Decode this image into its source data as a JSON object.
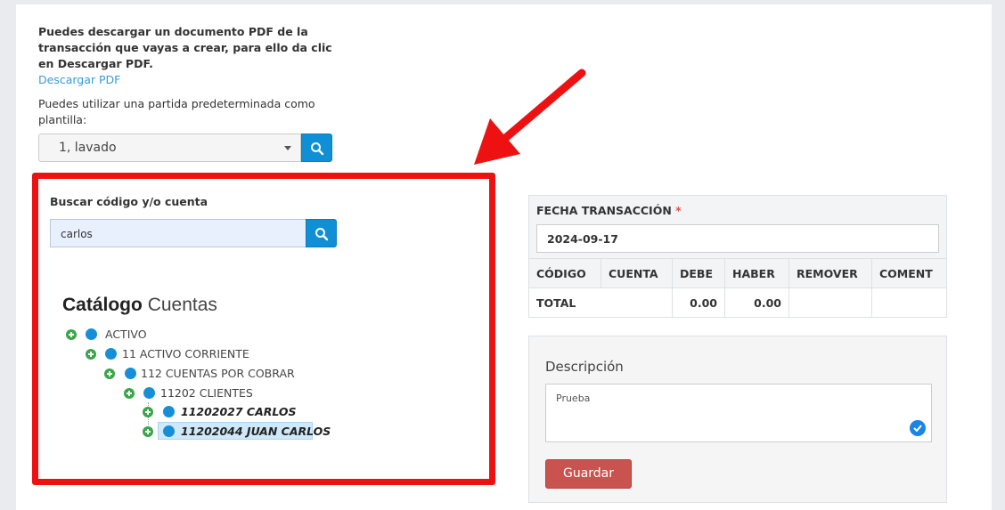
{
  "intro": {
    "text": "Puedes descargar un documento PDF de la transacción que vayas a crear, para ello da clic en Descargar PDF.",
    "download_link": "Descargar PDF"
  },
  "template": {
    "label": "Puedes utilizar una partida predeterminada como plantilla:",
    "selected": "1, lavado"
  },
  "search": {
    "label": "Buscar código y/o cuenta",
    "value": "carlos"
  },
  "catalog": {
    "title_bold": "Catálogo",
    "title_light": "Cuentas",
    "nodes": [
      {
        "label": "ACTIVO"
      },
      {
        "label": "11 ACTIVO CORRIENTE"
      },
      {
        "label": "112 CUENTAS POR COBRAR"
      },
      {
        "label": "11202 CLIENTES"
      },
      {
        "label": "11202027 CARLOS"
      },
      {
        "label": "11202044 JUAN CARLOS"
      }
    ]
  },
  "transaction": {
    "fecha_label": "FECHA TRANSACCIÓN",
    "required_mark": "*",
    "fecha_value": "2024-09-17",
    "columns": [
      "CÓDIGO",
      "CUENTA",
      "DEBE",
      "HABER",
      "REMOVER",
      "COMENT"
    ],
    "total_label": "TOTAL",
    "total_debe": "0.00",
    "total_haber": "0.00"
  },
  "description": {
    "label": "Descripción",
    "value": "Prueba",
    "save_label": "Guardar"
  },
  "colors": {
    "highlight_border": "#ee1111",
    "primary": "#0e8fd6",
    "danger": "#c9534f",
    "tree_plus": "#3aa64a"
  }
}
